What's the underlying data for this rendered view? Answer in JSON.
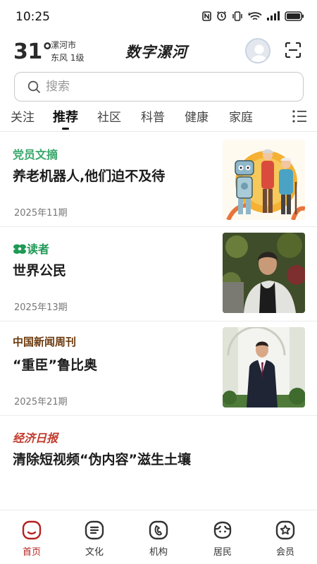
{
  "status_bar": {
    "time": "10:25",
    "icons": [
      "nfc-icon",
      "alarm-icon",
      "vibrate-icon",
      "wifi-6-icon",
      "signal-icon",
      "battery-icon"
    ]
  },
  "header": {
    "temperature": "31°",
    "city": "漯河市",
    "wind": "东风 1级",
    "title": "数字漯河"
  },
  "search": {
    "placeholder": "搜索"
  },
  "tabs": [
    {
      "label": "关注",
      "active": false
    },
    {
      "label": "推荐",
      "active": true
    },
    {
      "label": "社区",
      "active": false
    },
    {
      "label": "科普",
      "active": false
    },
    {
      "label": "健康",
      "active": false
    },
    {
      "label": "家庭",
      "active": false
    }
  ],
  "articles": [
    {
      "source": "党员文摘",
      "source_color": "#3aa86b",
      "headline": "养老机器人,他们迫不及待",
      "issue": "2025年11期",
      "image": "robot-and-elders-illustration"
    },
    {
      "source": "读者",
      "source_color": "#1f9a55",
      "headline": "世界公民",
      "issue": "2025年13期",
      "image": "man-portrait-photo"
    },
    {
      "source": "中国新闻周刊",
      "source_color": "#6b3a0e",
      "headline": "“重臣”鲁比奥",
      "issue": "2025年21期",
      "image": "man-in-suit-photo"
    },
    {
      "source": "经济日报",
      "source_color": "#c0392b",
      "headline": "清除短视频“伪内容”滋生土壤",
      "issue": "",
      "image": ""
    }
  ],
  "bottom_nav": [
    {
      "label": "首页",
      "icon": "home-icon",
      "active": true
    },
    {
      "label": "文化",
      "icon": "culture-icon",
      "active": false
    },
    {
      "label": "机构",
      "icon": "institution-icon",
      "active": false
    },
    {
      "label": "居民",
      "icon": "residents-icon",
      "active": false
    },
    {
      "label": "会员",
      "icon": "member-icon",
      "active": false
    }
  ],
  "colors": {
    "accent": "#b52020",
    "text": "#1a1a1a",
    "muted": "#777777"
  }
}
